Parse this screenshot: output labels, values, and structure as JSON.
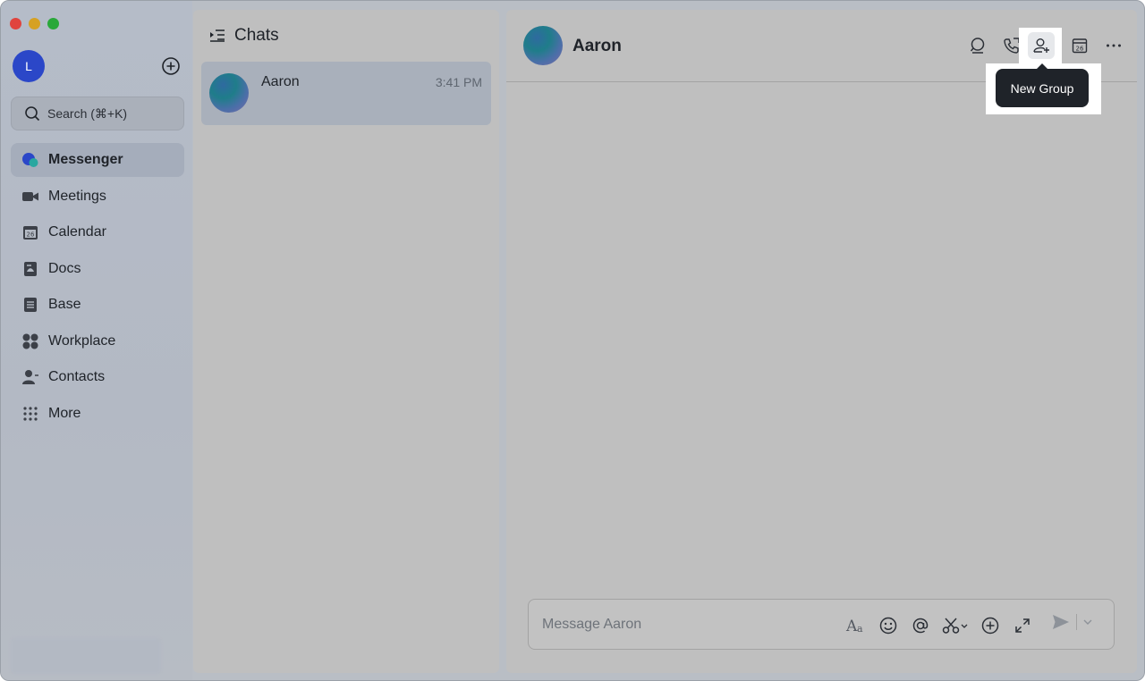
{
  "window": {
    "traffic": [
      "close",
      "minimize",
      "zoom"
    ]
  },
  "sidebar": {
    "user_initial": "L",
    "search": {
      "label": "Search (⌘+K)"
    },
    "items": [
      {
        "label": "Messenger",
        "icon": "messenger-icon",
        "active": true
      },
      {
        "label": "Meetings",
        "icon": "video-camera-icon"
      },
      {
        "label": "Calendar",
        "icon": "calendar-icon"
      },
      {
        "label": "Docs",
        "icon": "docs-icon"
      },
      {
        "label": "Base",
        "icon": "base-icon"
      },
      {
        "label": "Workplace",
        "icon": "grid-apps-icon"
      },
      {
        "label": "Contacts",
        "icon": "contacts-icon"
      },
      {
        "label": "More",
        "icon": "dots-grid-icon"
      }
    ]
  },
  "chat_list": {
    "title": "Chats",
    "chats": [
      {
        "name": "Aaron",
        "time": "3:41 PM"
      }
    ]
  },
  "conversation": {
    "name": "Aaron",
    "header_icons": [
      "search-chat-icon",
      "call-icon",
      "new-group-icon",
      "calendar-icon",
      "more-icon"
    ],
    "tooltip": "New Group",
    "composer": {
      "placeholder": "Message Aaron",
      "tools": [
        "format-icon",
        "emoji-icon",
        "mention-icon",
        "screenshot-icon",
        "add-icon",
        "expand-icon"
      ]
    }
  },
  "colors": {
    "accent": "#2b47c8",
    "tooltip_bg": "#1f2329"
  }
}
